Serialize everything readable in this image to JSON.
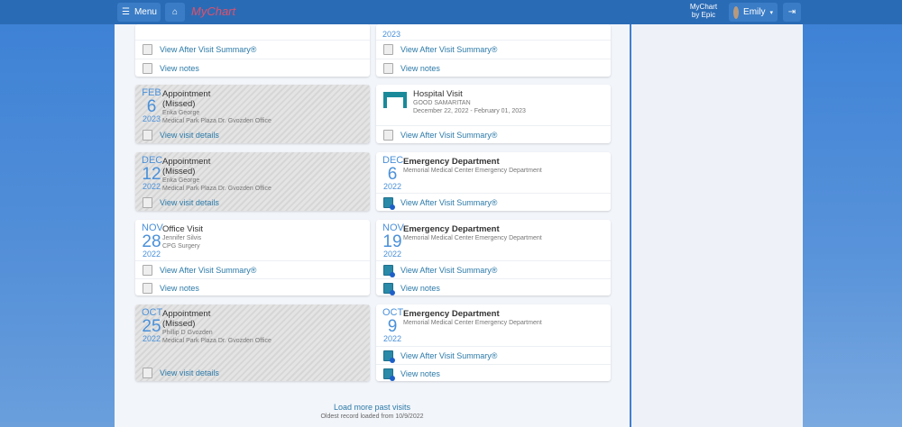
{
  "header": {
    "menu_label": "Menu",
    "logo": "MyChart",
    "brand": "MyChart by Epic",
    "user": "Emily"
  },
  "cards": {
    "top_left": {
      "actions": [
        "View After Visit Summary®",
        "View notes"
      ]
    },
    "top_right": {
      "year": "2023",
      "actions": [
        "View After Visit Summary®",
        "View notes"
      ]
    },
    "c1": {
      "month": "FEB",
      "day": "6",
      "year": "2023",
      "title": "Appointment",
      "status": "(Missed)",
      "provider": "Erika George",
      "location": "Medical Park Plaza Dr. Gvozden Office",
      "action": "View visit details"
    },
    "c2": {
      "title": "Hospital Visit",
      "facility": "GOOD SAMARITAN",
      "range": "December 22, 2022 - February 01, 2023",
      "action": "View After Visit Summary®",
      "icon": "hospital-bed-icon"
    },
    "c3": {
      "month": "DEC",
      "day": "12",
      "year": "2022",
      "title": "Appointment",
      "status": "(Missed)",
      "provider": "Erika George",
      "location": "Medical Park Plaza Dr. Gvozden Office",
      "action": "View visit details"
    },
    "c4": {
      "month": "DEC",
      "day": "6",
      "year": "2022",
      "title": "Emergency Department",
      "location": "Memorial Medical Center Emergency Department",
      "action": "View After Visit Summary®"
    },
    "c5": {
      "month": "NOV",
      "day": "28",
      "year": "2022",
      "title": "Office Visit",
      "provider": "Jennifer Silvis",
      "location": "CPG Surgery",
      "actions": [
        "View After Visit Summary®",
        "View notes"
      ]
    },
    "c6": {
      "month": "NOV",
      "day": "19",
      "year": "2022",
      "title": "Emergency Department",
      "location": "Memorial Medical Center Emergency Department",
      "actions": [
        "View After Visit Summary®",
        "View notes"
      ]
    },
    "c7": {
      "month": "OCT",
      "day": "25",
      "year": "2022",
      "title": "Appointment",
      "status": "(Missed)",
      "provider": "Phillip D Gvozden",
      "location": "Medical Park Plaza Dr. Gvozden Office",
      "action": "View visit details"
    },
    "c8": {
      "month": "OCT",
      "day": "9",
      "year": "2022",
      "title": "Emergency Department",
      "location": "Memorial Medical Center Emergency Department",
      "actions": [
        "View After Visit Summary®",
        "View notes"
      ]
    }
  },
  "footer": {
    "load_more": "Load more past visits",
    "oldest": "Oldest record loaded from 10/9/2022"
  },
  "colors": {
    "header": "#2a6bb5",
    "link": "#2c7aa8",
    "date": "#4a90d9"
  }
}
